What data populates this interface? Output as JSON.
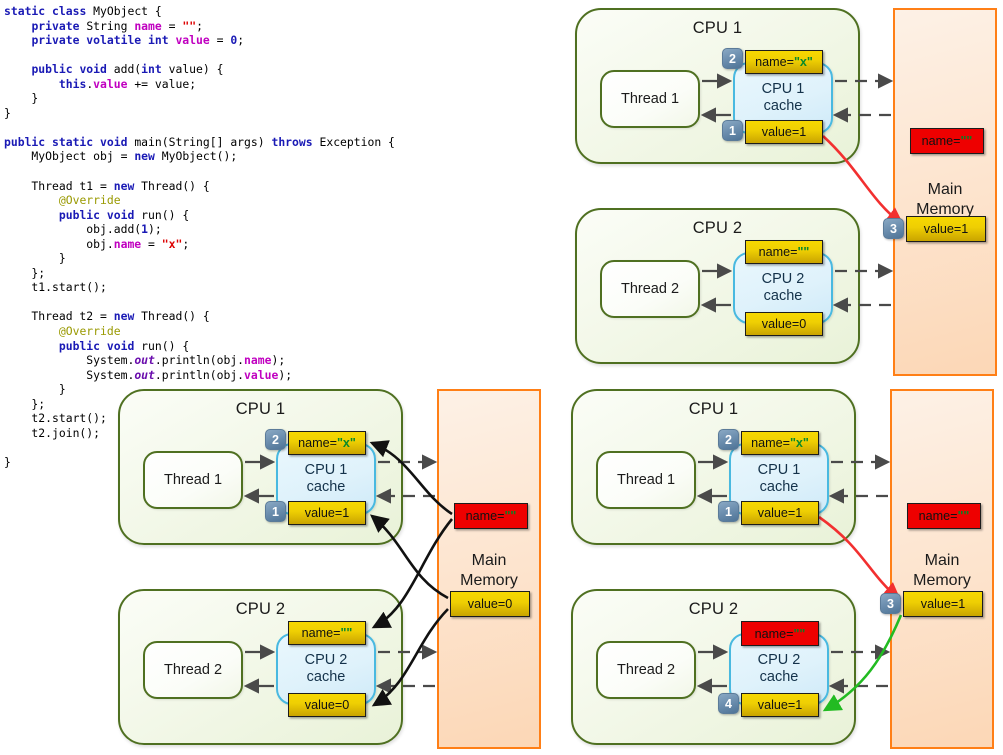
{
  "code": {
    "language": "java",
    "lines": [
      [
        {
          "t": "static ",
          "c": "kw"
        },
        {
          "t": "class ",
          "c": "kw"
        },
        {
          "t": "MyObject {",
          "c": "pln"
        }
      ],
      [
        {
          "t": "    ",
          "c": "pln"
        },
        {
          "t": "private ",
          "c": "kw"
        },
        {
          "t": "String ",
          "c": "pln"
        },
        {
          "t": "name",
          "c": "fld"
        },
        {
          "t": " = ",
          "c": "pln"
        },
        {
          "t": "\"\"",
          "c": "str"
        },
        {
          "t": ";",
          "c": "pln"
        }
      ],
      [
        {
          "t": "    ",
          "c": "pln"
        },
        {
          "t": "private volatile int ",
          "c": "kw"
        },
        {
          "t": "value",
          "c": "fld"
        },
        {
          "t": " = ",
          "c": "pln"
        },
        {
          "t": "0",
          "c": "num"
        },
        {
          "t": ";",
          "c": "pln"
        }
      ],
      [
        {
          "t": "",
          "c": "pln"
        }
      ],
      [
        {
          "t": "    ",
          "c": "pln"
        },
        {
          "t": "public void ",
          "c": "kw"
        },
        {
          "t": "add(",
          "c": "pln"
        },
        {
          "t": "int ",
          "c": "kw"
        },
        {
          "t": "value) {",
          "c": "pln"
        }
      ],
      [
        {
          "t": "        ",
          "c": "pln"
        },
        {
          "t": "this",
          "c": "kw"
        },
        {
          "t": ".",
          "c": "pln"
        },
        {
          "t": "value",
          "c": "fld"
        },
        {
          "t": " += value;",
          "c": "pln"
        }
      ],
      [
        {
          "t": "    }",
          "c": "pln"
        }
      ],
      [
        {
          "t": "}",
          "c": "pln"
        }
      ],
      [
        {
          "t": "",
          "c": "pln"
        }
      ],
      [
        {
          "t": "public static void ",
          "c": "kw"
        },
        {
          "t": "main(String[] args) ",
          "c": "pln"
        },
        {
          "t": "throws ",
          "c": "kw"
        },
        {
          "t": "Exception {",
          "c": "pln"
        }
      ],
      [
        {
          "t": "    MyObject obj = ",
          "c": "pln"
        },
        {
          "t": "new ",
          "c": "kw"
        },
        {
          "t": "MyObject();",
          "c": "pln"
        }
      ],
      [
        {
          "t": "",
          "c": "pln"
        }
      ],
      [
        {
          "t": "    Thread t1 = ",
          "c": "pln"
        },
        {
          "t": "new ",
          "c": "kw"
        },
        {
          "t": "Thread() {",
          "c": "pln"
        }
      ],
      [
        {
          "t": "        ",
          "c": "pln"
        },
        {
          "t": "@Override",
          "c": "ann"
        }
      ],
      [
        {
          "t": "        ",
          "c": "pln"
        },
        {
          "t": "public void ",
          "c": "kw"
        },
        {
          "t": "run() {",
          "c": "pln"
        }
      ],
      [
        {
          "t": "            obj.add(",
          "c": "pln"
        },
        {
          "t": "1",
          "c": "num"
        },
        {
          "t": ");",
          "c": "pln"
        }
      ],
      [
        {
          "t": "            obj.",
          "c": "pln"
        },
        {
          "t": "name",
          "c": "fld"
        },
        {
          "t": " = ",
          "c": "pln"
        },
        {
          "t": "\"x\"",
          "c": "str"
        },
        {
          "t": ";",
          "c": "pln"
        }
      ],
      [
        {
          "t": "        }",
          "c": "pln"
        }
      ],
      [
        {
          "t": "    };",
          "c": "pln"
        }
      ],
      [
        {
          "t": "    t1.start();",
          "c": "pln"
        }
      ],
      [
        {
          "t": "",
          "c": "pln"
        }
      ],
      [
        {
          "t": "    Thread t2 = ",
          "c": "pln"
        },
        {
          "t": "new ",
          "c": "kw"
        },
        {
          "t": "Thread() {",
          "c": "pln"
        }
      ],
      [
        {
          "t": "        ",
          "c": "pln"
        },
        {
          "t": "@Override",
          "c": "ann"
        }
      ],
      [
        {
          "t": "        ",
          "c": "pln"
        },
        {
          "t": "public void ",
          "c": "kw"
        },
        {
          "t": "run() {",
          "c": "pln"
        }
      ],
      [
        {
          "t": "            System.",
          "c": "pln"
        },
        {
          "t": "out",
          "c": "stat"
        },
        {
          "t": ".println(obj.",
          "c": "pln"
        },
        {
          "t": "name",
          "c": "fld"
        },
        {
          "t": ");",
          "c": "pln"
        }
      ],
      [
        {
          "t": "            System.",
          "c": "pln"
        },
        {
          "t": "out",
          "c": "stat"
        },
        {
          "t": ".println(obj.",
          "c": "pln"
        },
        {
          "t": "value",
          "c": "fld"
        },
        {
          "t": ");",
          "c": "pln"
        }
      ],
      [
        {
          "t": "        }",
          "c": "pln"
        }
      ],
      [
        {
          "t": "    };",
          "c": "pln"
        }
      ],
      [
        {
          "t": "    t2.start();",
          "c": "pln"
        }
      ],
      [
        {
          "t": "    t2.join();",
          "c": "pln"
        }
      ],
      [
        {
          "t": "",
          "c": "pln"
        }
      ],
      [
        {
          "t": "}",
          "c": "pln"
        }
      ]
    ]
  },
  "labels": {
    "cpu1": "CPU 1",
    "cpu2": "CPU 2",
    "thread1": "Thread 1",
    "thread2": "Thread 2",
    "cache1_l1": "CPU 1",
    "cache1_l2": "cache",
    "cache2_l1": "CPU 2",
    "cache2_l2": "cache",
    "main_memory_l1": "Main",
    "main_memory_l2": "Memory"
  },
  "colors": {
    "cpu_border": "#4f7021",
    "cache_border": "#49b9e0",
    "memory_border": "#ff7f16",
    "gold": "#efcf03",
    "red": "#ee0000",
    "badge": "#4e7396",
    "arrow_gray": "#4a4a4a",
    "arrow_red": "#f23030",
    "arrow_green": "#22bb22",
    "arrow_black": "#111111"
  },
  "diagram_tr": {
    "name": "top-right",
    "cpu1": {
      "title": "CPU 1",
      "thread": "Thread 1",
      "cache": "CPU 1 cache",
      "name_chip": {
        "prefix": "name=",
        "quoted": "\"x\""
      },
      "value_chip": "value=1",
      "name_badge": "2",
      "value_badge": "1",
      "name_chip_state": "gold",
      "value_chip_state": "gold"
    },
    "cpu2": {
      "title": "CPU 2",
      "thread": "Thread 2",
      "cache": "CPU 2 cache",
      "name_chip": {
        "prefix": "name=",
        "quoted": "\"\""
      },
      "value_chip": "value=0",
      "name_badge": "",
      "value_badge": "",
      "name_chip_state": "gold",
      "value_chip_state": "gold"
    },
    "memory": {
      "title_l1": "Main",
      "title_l2": "Memory",
      "name_chip": {
        "prefix": "name=",
        "quoted": "\"\""
      },
      "value_chip": "value=1",
      "value_badge": "3",
      "name_chip_state": "red",
      "value_chip_state": "gold"
    },
    "flow_arrows": [
      "red: cpu1 value=1 -> memory value=1"
    ]
  },
  "diagram_bl": {
    "name": "bottom-left",
    "cpu1": {
      "title": "CPU 1",
      "thread": "Thread 1",
      "cache": "CPU 1 cache",
      "name_chip": {
        "prefix": "name=",
        "quoted": "\"x\""
      },
      "value_chip": "value=1",
      "name_badge": "2",
      "value_badge": "1",
      "name_chip_state": "gold",
      "value_chip_state": "gold"
    },
    "cpu2": {
      "title": "CPU 2",
      "thread": "Thread 2",
      "cache": "CPU 2 cache",
      "name_chip": {
        "prefix": "name=",
        "quoted": "\"\""
      },
      "value_chip": "value=0",
      "name_badge": "",
      "value_badge": "",
      "name_chip_state": "gold",
      "value_chip_state": "gold"
    },
    "memory": {
      "title_l1": "Main",
      "title_l2": "Memory",
      "name_chip": {
        "prefix": "name=",
        "quoted": "\"\""
      },
      "value_chip": "value=0",
      "value_badge": "",
      "name_chip_state": "red",
      "value_chip_state": "gold"
    },
    "flow_arrows": [
      "black: memory name -> cpu1 name",
      "black: memory name -> cpu2 name",
      "black: memory value -> cpu1 value",
      "black: memory value -> cpu2 value"
    ]
  },
  "diagram_br": {
    "name": "bottom-right",
    "cpu1": {
      "title": "CPU 1",
      "thread": "Thread 1",
      "cache": "CPU 1 cache",
      "name_chip": {
        "prefix": "name=",
        "quoted": "\"x\""
      },
      "value_chip": "value=1",
      "name_badge": "2",
      "value_badge": "1",
      "name_chip_state": "gold",
      "value_chip_state": "gold"
    },
    "cpu2": {
      "title": "CPU 2",
      "thread": "Thread 2",
      "cache": "CPU 2 cache",
      "name_chip": {
        "prefix": "name=",
        "quoted": "\"\""
      },
      "value_chip": "value=1",
      "name_badge": "",
      "value_badge": "4",
      "name_chip_state": "red",
      "value_chip_state": "gold"
    },
    "memory": {
      "title_l1": "Main",
      "title_l2": "Memory",
      "name_chip": {
        "prefix": "name=",
        "quoted": "\"\""
      },
      "value_chip": "value=1",
      "value_badge": "3",
      "name_chip_state": "red",
      "value_chip_state": "gold"
    },
    "flow_arrows": [
      "red: cpu1 value=1 -> memory value=1",
      "green: memory value=1 -> cpu2 value=1"
    ]
  }
}
